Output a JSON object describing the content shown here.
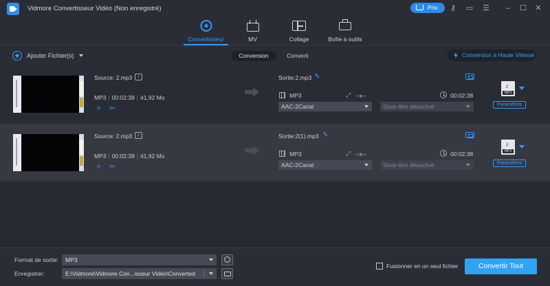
{
  "window": {
    "title": "Vidmore Convertisseur Vidéo (Non enregistré)",
    "price_label": "Prix",
    "icons": [
      "key-icon",
      "chat-icon",
      "menu-icon",
      "minimize-icon",
      "maximize-icon",
      "close-icon"
    ]
  },
  "nav": {
    "tabs": [
      {
        "label": "Convertisseur",
        "icon": "convert-icon",
        "active": true
      },
      {
        "label": "MV",
        "icon": "tv-icon",
        "active": false
      },
      {
        "label": "Collage",
        "icon": "collage-icon",
        "active": false
      },
      {
        "label": "Boîte à outils",
        "icon": "toolbox-icon",
        "active": false
      }
    ]
  },
  "toolbar": {
    "add_files": "Ajouter Fichier(s)",
    "tab_conversion": "Conversion",
    "tab_converted": "Converti",
    "high_speed": "Conversion à Haute Vitesse"
  },
  "files": [
    {
      "source": "Source: 2.mp3",
      "format": "MP3",
      "duration": "00:02:38",
      "size": "41,92 Mo",
      "output_name": "Sortie:2.mp3",
      "output_format": "MP3",
      "resolution": "--x--",
      "output_duration": "00:02:38",
      "audio_track": "AAC-2Canal",
      "subtitle": "Sous-titre désactivé",
      "format_tag": "MP3",
      "params_label": "Paramètres"
    },
    {
      "source": "Source: 2.mp3",
      "format": "MP3",
      "duration": "00:02:38",
      "size": "41,92 Mo",
      "output_name": "Sortie:2(1).mp3",
      "output_format": "MP3",
      "resolution": "--x--",
      "output_duration": "00:02:38",
      "audio_track": "AAC-2Canal",
      "subtitle": "Sous-titre désactivé",
      "format_tag": "MP3",
      "params_label": "Paramètres"
    }
  ],
  "bottom": {
    "output_format_label": "Format de sortie:",
    "output_format_value": "MP3",
    "save_label": "Enregistrer:",
    "save_path": "E:\\Vidmore\\Vidmore Con...isseur Vidéo\\Converted",
    "merge_label": "Fusionner en un seul fichier",
    "convert_all": "Convertir Tout"
  },
  "colors": {
    "accent": "#2f9bff",
    "button": "#31a3f5",
    "background": "#282a33"
  }
}
